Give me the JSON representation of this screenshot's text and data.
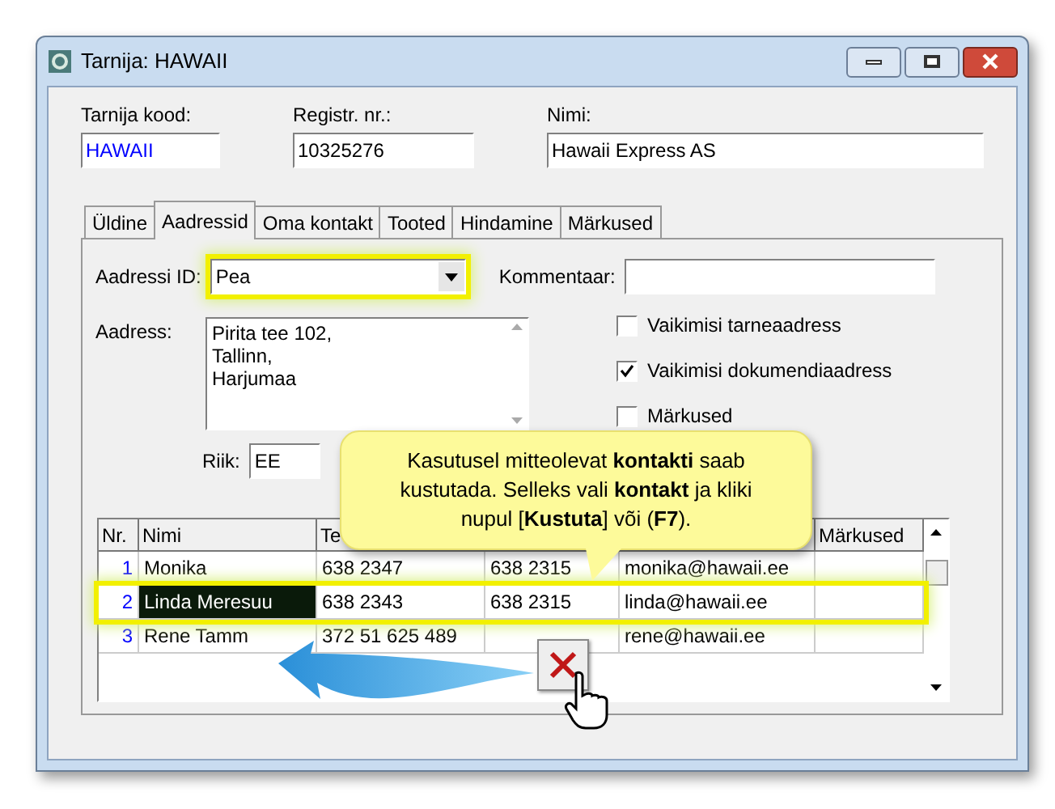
{
  "window": {
    "title": "Tarnija: HAWAII"
  },
  "fields": [
    {
      "label": "Tarnija kood:",
      "value": "HAWAII",
      "kind": "code"
    },
    {
      "label": "Registr. nr.:",
      "value": "10325276",
      "kind": "text"
    },
    {
      "label": "Nimi:",
      "value": "Hawaii Express AS",
      "kind": "text"
    }
  ],
  "tabs": [
    {
      "label": "Üldine",
      "selected": false
    },
    {
      "label": "Aadressid",
      "selected": true
    },
    {
      "label": "Oma kontakt",
      "selected": false
    },
    {
      "label": "Tooted",
      "selected": false
    },
    {
      "label": "Hindamine",
      "selected": false
    },
    {
      "label": "Märkused",
      "selected": false
    }
  ],
  "address_id": {
    "label": "Aadressi ID:",
    "value": "Pea",
    "highlighted": true
  },
  "comment": {
    "label": "Kommentaar:"
  },
  "address": {
    "label": "Aadress:",
    "lines": [
      "Pirita tee 102,",
      "Tallinn,",
      "Harjumaa"
    ]
  },
  "checkboxes": [
    {
      "label": "Vaikimisi tarneaadress",
      "checked": false
    },
    {
      "label": "Vaikimisi dokumendiaadress",
      "checked": true
    },
    {
      "label": "Märkused",
      "checked": false
    }
  ],
  "country": {
    "label": "Riik:",
    "value": "EE"
  },
  "contacts": {
    "columns": [
      "Nr.",
      "Nimi",
      "Te",
      "",
      "",
      "Märkused"
    ],
    "rows": [
      {
        "cells": [
          "1",
          "Monika",
          "638 2347",
          "638 2315",
          "monika@hawaii.ee",
          ""
        ],
        "selected": false
      },
      {
        "cells": [
          "2",
          "Linda Meresuu",
          "638 2343",
          "638 2315",
          "linda@hawaii.ee",
          ""
        ],
        "selected": true
      },
      {
        "cells": [
          "3",
          "Rene Tamm",
          "372 51 625 489",
          "",
          "rene@hawaii.ee",
          ""
        ],
        "selected": false
      }
    ]
  },
  "callout": {
    "text": "Kasutusel mitteolevat **kontakti** saab kustutada.  Selleks vali **kontakt** ja kliki nupul [**Kustuta**] või (**F7**)."
  }
}
